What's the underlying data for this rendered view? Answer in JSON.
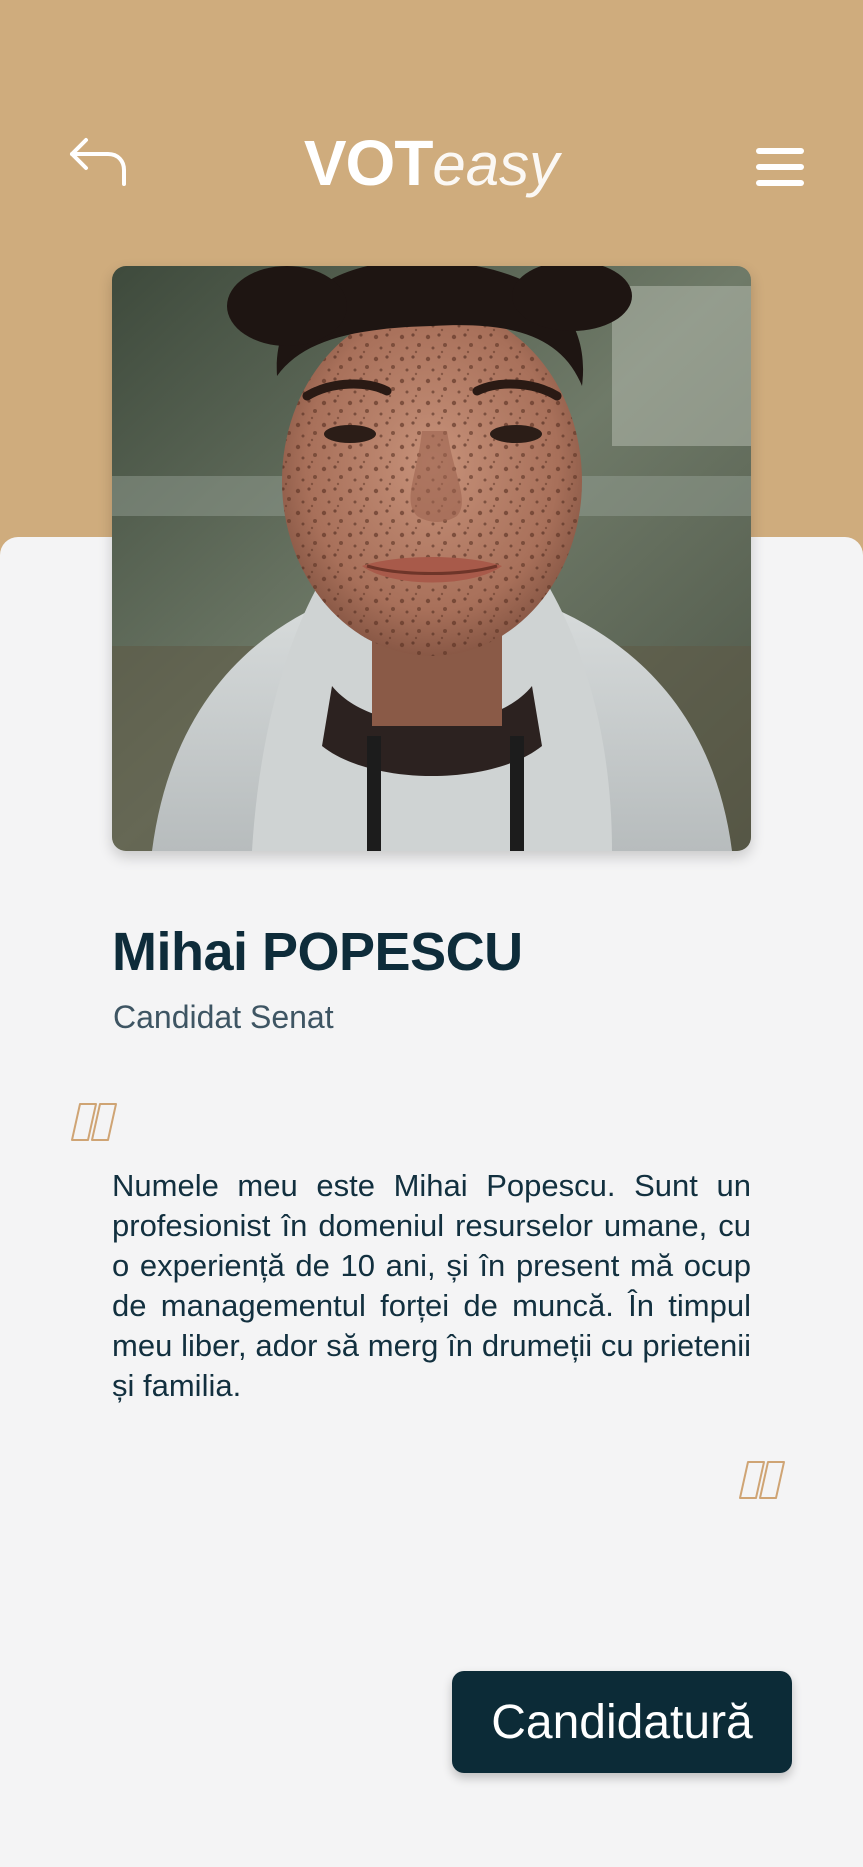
{
  "header": {
    "logo_strong": "VOT",
    "logo_light": "easy",
    "back_icon": "back-arrow-icon",
    "menu_icon": "hamburger-menu-icon"
  },
  "candidate": {
    "name": "Mihai POPESCU",
    "role": "Candidat Senat",
    "photo_alt": "Portrait photo of Mihai Popescu",
    "bio": "Numele meu este Mihai Popescu. Sunt un profesionist în domeniul resurselor umane, cu o experiență de 10 ani, și în present mă ocup de managementul forței de muncă. În timpul meu liber, ador să merg în drumeții cu prietenii și familia."
  },
  "actions": {
    "apply_label": "Candidatură"
  },
  "colors": {
    "header_bg": "#cfac7d",
    "page_bg": "#f4f4f5",
    "primary_dark": "#0c2b37",
    "quote_accent": "#cfa474"
  }
}
